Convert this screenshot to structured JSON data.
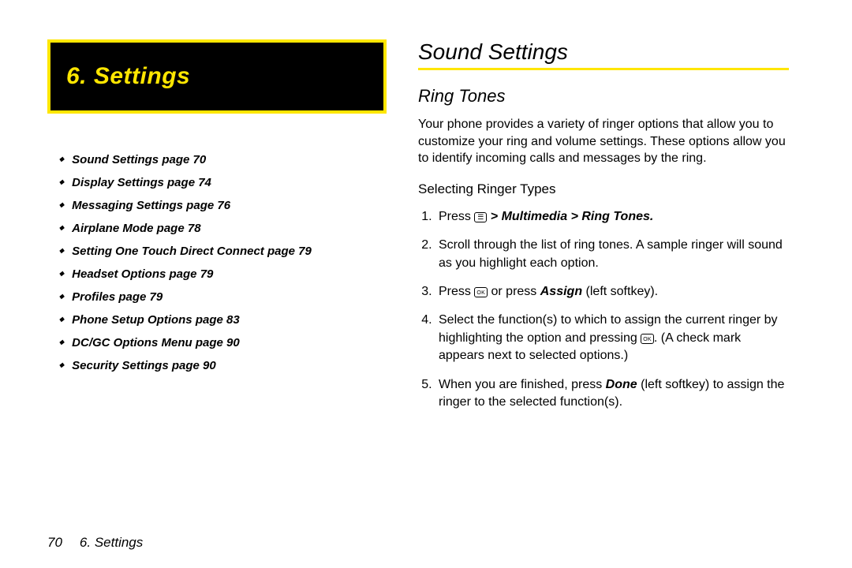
{
  "chapter_heading": "6. Settings",
  "toc": [
    "Sound Settings page 70",
    "Display Settings page 74",
    "Messaging Settings page 76",
    "Airplane Mode page 78",
    "Setting One Touch Direct Connect page 79",
    "Headset Options page 79",
    "Profiles page 79",
    "Phone Setup Options page 83",
    "DC/GC Options Menu page 90",
    "Security Settings page 90"
  ],
  "h1": "Sound Settings",
  "h2": "Ring Tones",
  "intro": "Your phone provides a variety of ringer options that allow you to customize your ring and volume settings. These options allow you to identify incoming calls and messages by the ring.",
  "h3": "Selecting Ringer Types",
  "steps": {
    "s1a": "Press ",
    "s1b": " > Multimedia > Ring Tones.",
    "s2": "Scroll through the list of ring tones. A sample ringer will sound as you highlight each option.",
    "s3a": "Press ",
    "s3b": " or press ",
    "s3c": "Assign",
    "s3d": " (left softkey).",
    "s4a": "Select the function(s) to which to assign the current ringer by highlighting the option and pressing ",
    "s4b": ". (A check mark appears next to selected options.)",
    "s5a": " When you are finished, press ",
    "s5b": "Done",
    "s5c": " (left softkey) to assign the ringer to the selected function(s)."
  },
  "footer": {
    "page": "70",
    "label": "6. Settings"
  }
}
